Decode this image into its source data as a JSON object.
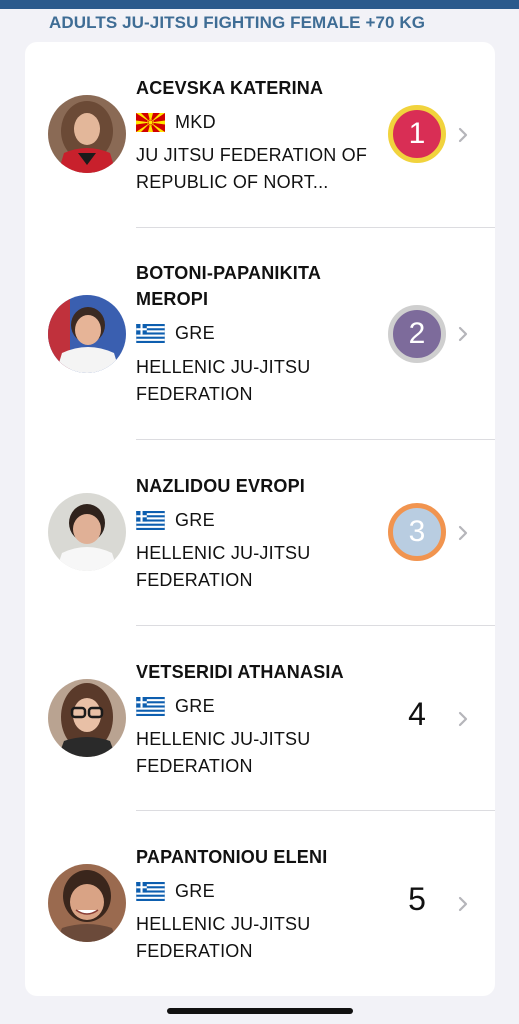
{
  "header": {
    "section_title": "ADULTS JU-JITSU FIGHTING FEMALE +70 KG"
  },
  "results": [
    {
      "name": "ACEVSKA KATERINA",
      "country_code": "MKD",
      "flag_icon": "north-macedonia-flag",
      "club": "JU JITSU FEDERATION OF REPUBLIC OF NORT...",
      "rank": "1",
      "medal": "gold"
    },
    {
      "name": "BOTONI-PAPANIKITA MEROPI",
      "country_code": "GRE",
      "flag_icon": "greece-flag",
      "club": "HELLENIC JU-JITSU FEDERATION",
      "rank": "2",
      "medal": "silver"
    },
    {
      "name": "NAZLIDOU EVROPI",
      "country_code": "GRE",
      "flag_icon": "greece-flag",
      "club": "HELLENIC JU-JITSU FEDERATION",
      "rank": "3",
      "medal": "bronze"
    },
    {
      "name": "VETSERIDI ATHANASIA",
      "country_code": "GRE",
      "flag_icon": "greece-flag",
      "club": "HELLENIC JU-JITSU FEDERATION",
      "rank": "4",
      "medal": "none"
    },
    {
      "name": "PAPANTONIOU ELENI",
      "country_code": "GRE",
      "flag_icon": "greece-flag",
      "club": "HELLENIC JU-JITSU FEDERATION",
      "rank": "5",
      "medal": "none"
    }
  ],
  "colors": {
    "header_bar": "#2b5a8c",
    "section_title": "#3f6d95",
    "gold_fill": "#d92e55",
    "gold_ring": "#f1d33d",
    "silver_fill": "#7d6b9b",
    "silver_ring": "#cfcfcf",
    "bronze_fill": "#b9cde1",
    "bronze_ring": "#f1944f"
  }
}
